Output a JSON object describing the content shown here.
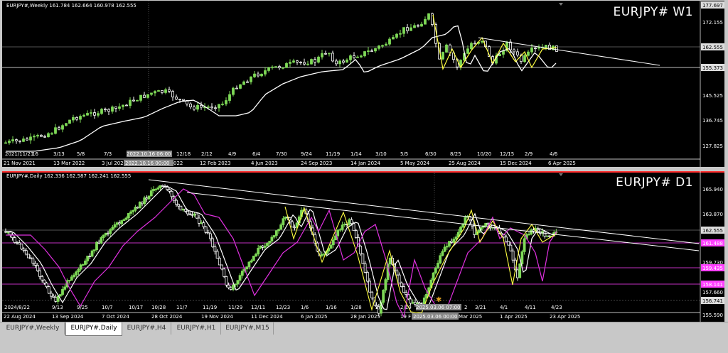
{
  "weekly": {
    "header": "EURJPY#,Weekly  161.784 162.664 160.978 162.555",
    "big_label": "EURJPY#  W1",
    "prices": [
      "177.697",
      "172.155",
      "162.555",
      "155.373",
      "145.525",
      "136.745",
      "127.825"
    ],
    "date_labels": [
      "21 Nov 2021",
      "13 Mar 2022",
      "3 Jul 2022",
      "23 Oct 2022",
      "12 Feb 2023",
      "4 Jun 2023",
      "24 Sep 2023",
      "14 Jan 2024",
      "5 May 2024",
      "25 Aug 2024",
      "15 Dec 2024",
      "6 Apr 2025"
    ],
    "inner_labels": [
      "2021/11/21",
      "16",
      "3/13",
      "5/8",
      "7/3",
      "2022.10.16 06:00",
      "12/18",
      "2/12",
      "4/9",
      "6/4",
      "7/30",
      "9/24",
      "11/19",
      "1/14",
      "3/10",
      "5/5",
      "6/30",
      "8/25",
      "10/20",
      "12/15",
      "2/9",
      "4/6"
    ],
    "cursor_label": "2022.10.16 00:00",
    "cursor_suffix": "022"
  },
  "daily": {
    "header": "EURJPY#,Daily  162.336 162.587 162.241 162.555",
    "big_label": "EURJPY#  D1",
    "prices": [
      "165.940",
      "163.870",
      "162.555",
      "161.488",
      "159.730",
      "159.435",
      "158.141",
      "157.660",
      "156.741",
      "155.590"
    ],
    "date_labels": [
      "22 Aug 2024",
      "13 Sep 2024",
      "7 Oct 2024",
      "28 Oct 2024",
      "19 Nov 2024",
      "11 Dec 2024",
      "6 Jan 2025",
      "28 Jan 2025",
      "19 F",
      "Mar 2025",
      "1 Apr 2025",
      "23 Apr 2025"
    ],
    "inner_labels": [
      "2024/8/22",
      "9/13",
      "9/25",
      "10/7",
      "10/17",
      "10/28",
      "11/7",
      "11/19",
      "11/29",
      "12/11",
      "12/23",
      "1/6",
      "1/16",
      "1/28",
      "2/7",
      "2/19",
      "2025.03.06 07:00",
      "2",
      "3/21",
      "4/1",
      "4/11",
      "4/23"
    ],
    "cursor_label": "2025.03.06 00:00"
  },
  "tabs": [
    "EURJPY#,Weekly",
    "EURJPY#,Daily",
    "EURJPY#,H4",
    "EURJPY#,H1",
    "EURJPY#,M15"
  ],
  "active_tab": "EURJPY#,Daily",
  "colors": {
    "bull": "#7ed957",
    "bear": "#ffffff",
    "ma_white": "#ffffff",
    "ma_magenta": "#e030e0",
    "yellow": "#ffff40",
    "level_magenta": "#ff40ff"
  }
}
